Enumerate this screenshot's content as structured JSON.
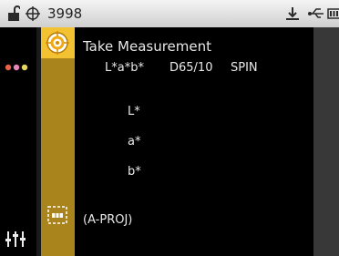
{
  "status_bar": {
    "instrument_id": "3998",
    "icons": [
      "lock-icon",
      "crosshair-icon",
      "download-icon",
      "usb-icon",
      "battery-icon"
    ]
  },
  "sidebar": {
    "icons": [
      "dots-icon",
      "sliders-icon"
    ]
  },
  "job_column": {
    "icons": [
      "target-icon",
      "project-icon"
    ],
    "colors": {
      "active": "#f3c233",
      "column": "#a9841d"
    }
  },
  "measurement": {
    "title": "Take Measurement",
    "color_space": "L*a*b*",
    "illuminant": "D65/10",
    "mode": "SPIN",
    "labels": {
      "L": "L*",
      "a": "a*",
      "b": "b*"
    },
    "project": "(A-PROJ)"
  }
}
